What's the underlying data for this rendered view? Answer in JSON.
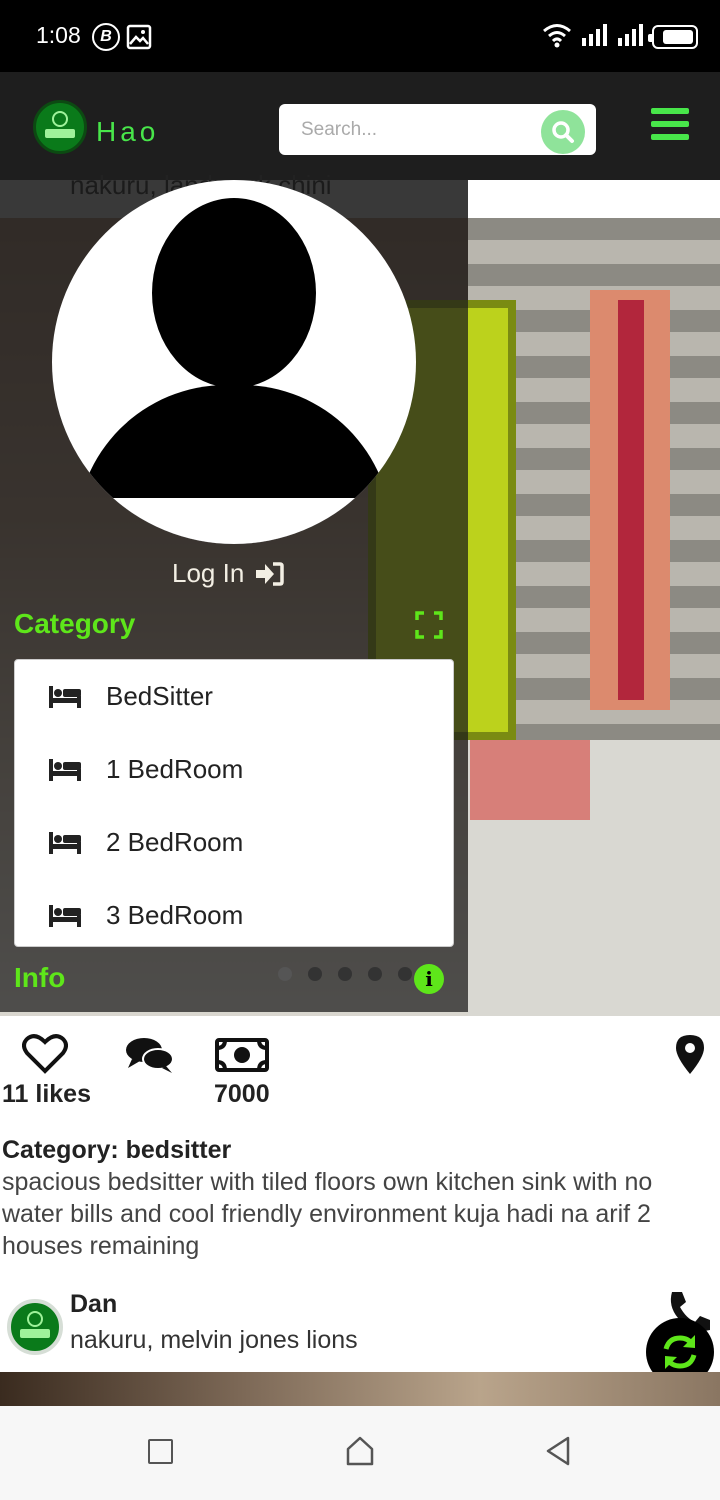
{
  "status_bar": {
    "time": "1:08",
    "b_badge": "B"
  },
  "header": {
    "app_name": "Hao",
    "search_placeholder": "Search..."
  },
  "behind_post": {
    "location_partial": "nakuru, landmark chini"
  },
  "drawer": {
    "login_label": "Log In",
    "category_title": "Category",
    "categories": [
      "BedSitter",
      "1 BedRoom",
      "2 BedRoom",
      "3 BedRoom"
    ],
    "info_title": "Info",
    "info_icon_label": "i"
  },
  "post": {
    "likes": "11 likes",
    "price": "7000",
    "category": "Category: bedsitter",
    "description": "spacious bedsitter with tiled floors own kitchen sink with no water bills and cool friendly environment kuja hadi na arif 2 houses remaining"
  },
  "next_post": {
    "name": "Dan",
    "location": "nakuru, melvin jones lions"
  },
  "colors": {
    "accent_green": "#5ee61a",
    "header_bg": "#1e1e1e",
    "search_btn": "#8fe39a"
  }
}
